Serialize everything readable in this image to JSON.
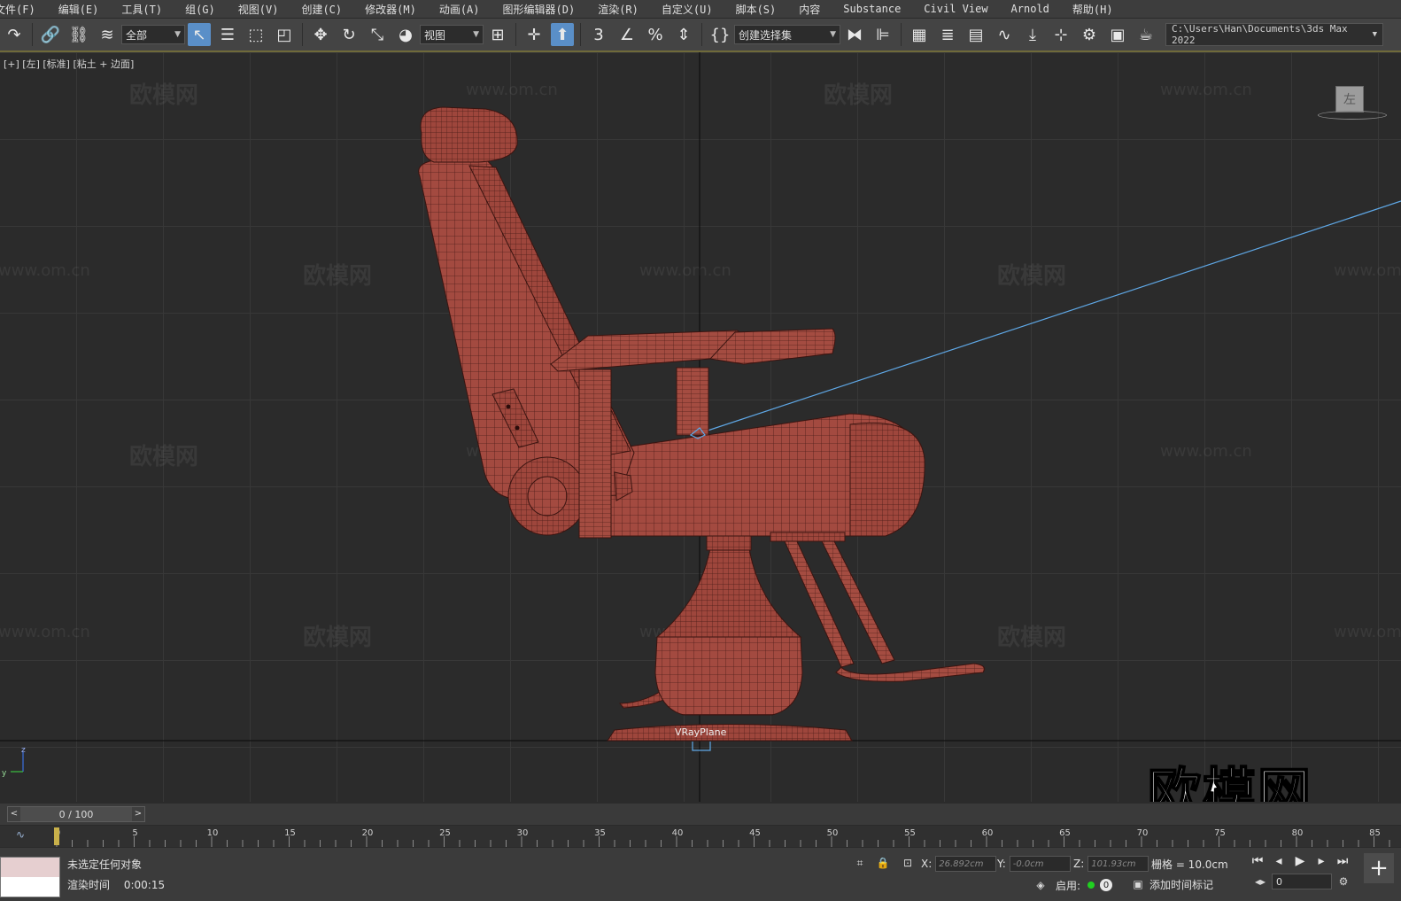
{
  "menu": [
    "文件(F)",
    "编辑(E)",
    "工具(T)",
    "组(G)",
    "视图(V)",
    "创建(C)",
    "修改器(M)",
    "动画(A)",
    "图形编辑器(D)",
    "渲染(R)",
    "自定义(U)",
    "脚本(S)",
    "内容",
    "Substance",
    "Civil View",
    "Arnold",
    "帮助(H)"
  ],
  "toolbar": {
    "selection_filter": "全部",
    "ref_coord": "视图",
    "named_selection": "创建选择集",
    "project_path": "C:\\Users\\Han\\Documents\\3ds Max 2022",
    "angle_snap_label": "3"
  },
  "viewport": {
    "label": "[+] [左] [标准] [粘土 + 边面]",
    "viewcube_face": "左",
    "object_label": "VRayPlane",
    "watermark_text": "欧模网",
    "watermark_url": "www.om.cn",
    "watermark_big": "欧模网",
    "axis_labels": {
      "z": "z",
      "y": "y"
    }
  },
  "timeline": {
    "slider_text": "0 / 100",
    "ticks": [
      "0",
      "5",
      "10",
      "15",
      "20",
      "25",
      "30",
      "35",
      "40",
      "45",
      "50",
      "55",
      "60",
      "65",
      "70",
      "75",
      "80",
      "85"
    ]
  },
  "status": {
    "selection": "未选定任何对象",
    "render_time_label": "渲染时间",
    "render_time_value": "0:00:15",
    "x_label": "X:",
    "x_value": "26.892cm",
    "y_label": "Y:",
    "y_value": "-0.0cm",
    "z_label": "Z:",
    "z_value": "101.93cm",
    "grid": "栅格 = 10.0cm",
    "enable_label": "启用:",
    "enable_count": "0",
    "add_time_tag": "添加时间标记",
    "frame_value": "0"
  },
  "colors": {
    "accent": "#5a8fc8",
    "model": "#a34a40",
    "wire": "#4a1c18",
    "light_line": "#5fa8e6"
  }
}
